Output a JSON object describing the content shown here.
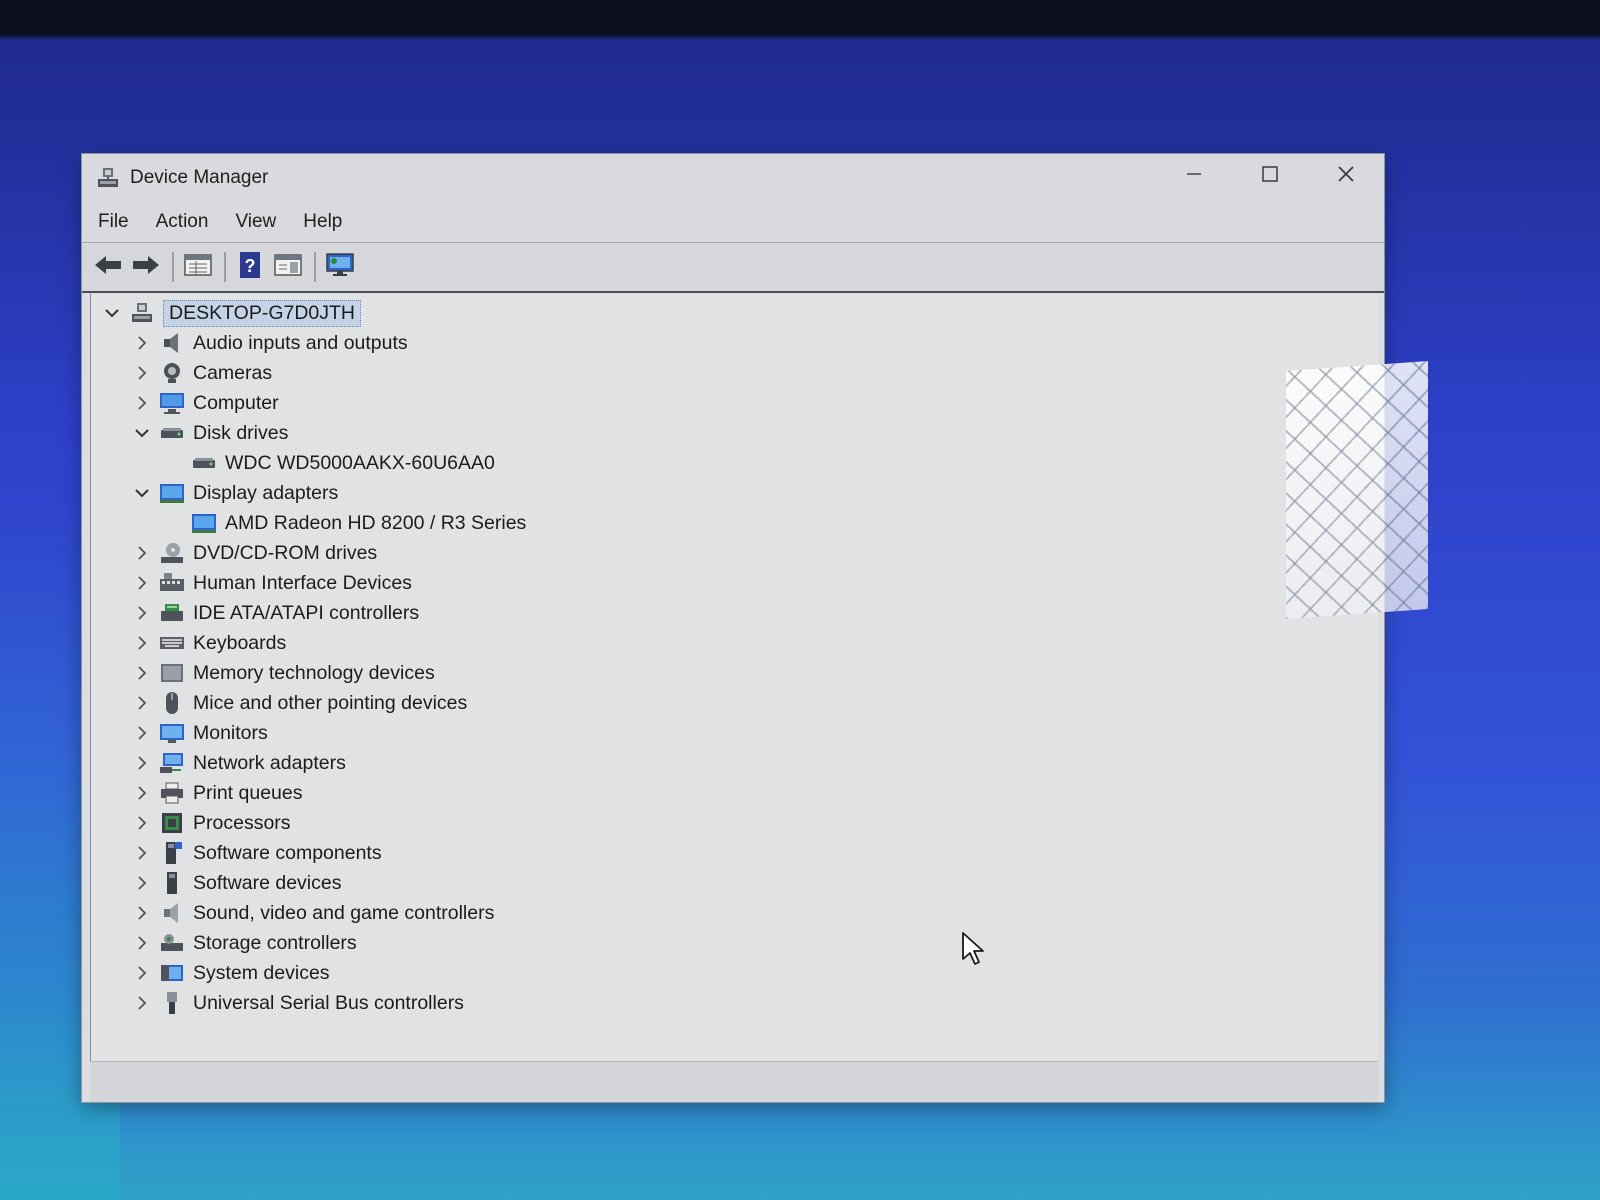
{
  "window": {
    "title": "Device Manager"
  },
  "menu": [
    "File",
    "Action",
    "View",
    "Help"
  ],
  "toolbar": {
    "buttons": [
      "back-arrow-icon",
      "forward-arrow-icon",
      "properties-icon",
      "help-icon",
      "action-pane-icon",
      "monitor-scan-icon"
    ]
  },
  "tree": {
    "root": "DESKTOP-G7D0JTH",
    "categories": [
      {
        "label": "Audio inputs and outputs",
        "icon": "speaker-icon",
        "expanded": false
      },
      {
        "label": "Cameras",
        "icon": "camera-icon",
        "expanded": false
      },
      {
        "label": "Computer",
        "icon": "computer-icon",
        "expanded": false
      },
      {
        "label": "Disk drives",
        "icon": "disk-drive-icon",
        "expanded": true,
        "children": [
          "WDC WD5000AAKX-60U6AA0"
        ]
      },
      {
        "label": "Display adapters",
        "icon": "display-adapter-icon",
        "expanded": true,
        "children": [
          "AMD Radeon HD 8200 / R3 Series"
        ]
      },
      {
        "label": "DVD/CD-ROM drives",
        "icon": "dvd-drive-icon",
        "expanded": false
      },
      {
        "label": "Human Interface Devices",
        "icon": "hid-icon",
        "expanded": false
      },
      {
        "label": "IDE ATA/ATAPI controllers",
        "icon": "ide-controller-icon",
        "expanded": false
      },
      {
        "label": "Keyboards",
        "icon": "keyboard-icon",
        "expanded": false
      },
      {
        "label": "Memory technology devices",
        "icon": "memory-icon",
        "expanded": false
      },
      {
        "label": "Mice and other pointing devices",
        "icon": "mouse-icon",
        "expanded": false
      },
      {
        "label": "Monitors",
        "icon": "monitor-icon",
        "expanded": false
      },
      {
        "label": "Network adapters",
        "icon": "network-icon",
        "expanded": false
      },
      {
        "label": "Print queues",
        "icon": "printer-icon",
        "expanded": false
      },
      {
        "label": "Processors",
        "icon": "processor-icon",
        "expanded": false
      },
      {
        "label": "Software components",
        "icon": "software-component-icon",
        "expanded": false
      },
      {
        "label": "Software devices",
        "icon": "software-device-icon",
        "expanded": false
      },
      {
        "label": "Sound, video and game controllers",
        "icon": "sound-icon",
        "expanded": false
      },
      {
        "label": "Storage controllers",
        "icon": "storage-icon",
        "expanded": false
      },
      {
        "label": "System devices",
        "icon": "system-devices-icon",
        "expanded": false
      },
      {
        "label": "Universal Serial Bus controllers",
        "icon": "usb-icon",
        "expanded": false
      }
    ]
  },
  "colors": {
    "selection": "#c5d3e6",
    "window_bg": "#e1e2e4",
    "desktop": "#2d40c8"
  }
}
